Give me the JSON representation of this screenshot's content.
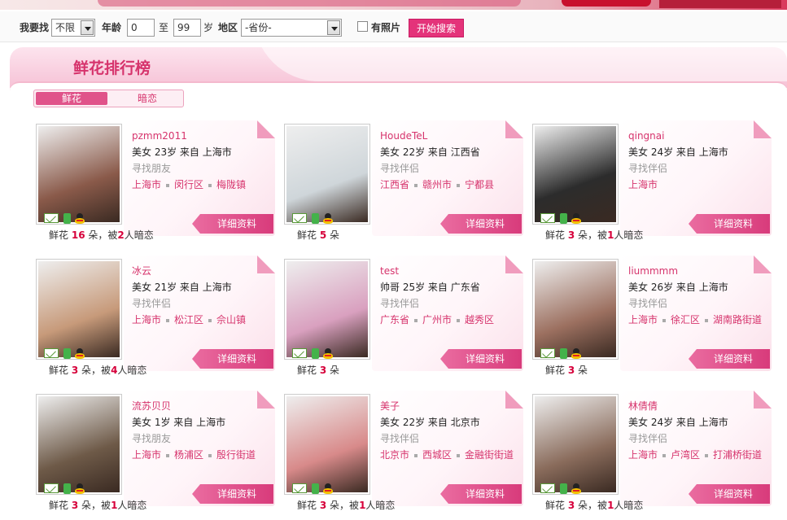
{
  "search": {
    "find_label": "我要找",
    "gender_value": "不限",
    "age_label": "年龄",
    "age_min": "0",
    "age_to": "至",
    "age_max": "99",
    "age_unit": "岁",
    "region_label": "地区",
    "region_value": "-省份-",
    "photo_label": "有照片",
    "search_button": "开始搜索"
  },
  "panel": {
    "title": "鲜花排行榜",
    "tabs": [
      {
        "label": "鲜花",
        "active": true
      },
      {
        "label": "暗恋",
        "active": false
      }
    ]
  },
  "detail_label": "详细资料",
  "cards": [
    {
      "nick": "pzmm2011",
      "desc": "美女 23岁 来自 上海市",
      "purpose": "寻找朋友",
      "loc": [
        "上海市",
        "闵行区",
        "梅陇镇"
      ],
      "flowers": "16",
      "crush": "2",
      "photo_color": "#8a5a4a"
    },
    {
      "nick": "HoudeTeL",
      "desc": "美女 22岁 来自 江西省",
      "purpose": "寻找伴侣",
      "loc": [
        "江西省",
        "赣州市",
        "宁都县"
      ],
      "flowers": "5",
      "crush": null,
      "photo_color": "#cfd6da"
    },
    {
      "nick": "qingnai",
      "desc": "美女 24岁 来自 上海市",
      "purpose": "寻找伴侣",
      "loc": [
        "上海市"
      ],
      "flowers": "3",
      "crush": "1",
      "photo_color": "#2c2c2c"
    },
    {
      "nick": "冰云",
      "desc": "美女 21岁 来自 上海市",
      "purpose": "寻找伴侣",
      "loc": [
        "上海市",
        "松江区",
        "佘山镇"
      ],
      "flowers": "3",
      "crush": "4",
      "photo_color": "#c79a7a"
    },
    {
      "nick": "test",
      "desc": "帅哥 25岁 来自 广东省",
      "purpose": "寻找伴侣",
      "loc": [
        "广东省",
        "广州市",
        "越秀区"
      ],
      "flowers": "3",
      "crush": null,
      "photo_color": "#d9a0bf"
    },
    {
      "nick": "liummmm",
      "desc": "美女 26岁 来自 上海市",
      "purpose": "寻找伴侣",
      "loc": [
        "上海市",
        "徐汇区",
        "湖南路街道"
      ],
      "flowers": "3",
      "crush": null,
      "photo_color": "#9c7060"
    },
    {
      "nick": "流苏贝贝",
      "desc": "美女 1岁 来自 上海市",
      "purpose": "寻找朋友",
      "loc": [
        "上海市",
        "杨浦区",
        "殷行街道"
      ],
      "flowers": "3",
      "crush": "1",
      "photo_color": "#6e5a48"
    },
    {
      "nick": "美子",
      "desc": "美女 22岁 来自 北京市",
      "purpose": "寻找伴侣",
      "loc": [
        "北京市",
        "西城区",
        "金融街街道"
      ],
      "flowers": "3",
      "crush": "1",
      "photo_color": "#d88a8a"
    },
    {
      "nick": "林倩倩",
      "desc": "美女 24岁 来自 上海市",
      "purpose": "寻找伴侣",
      "loc": [
        "上海市",
        "卢湾区",
        "打浦桥街道"
      ],
      "flowers": "3",
      "crush": "1",
      "photo_color": "#8a6c5c"
    }
  ],
  "flowers_prefix": "鲜花",
  "flowers_unit": "朵",
  "crush_prefix": "，被",
  "crush_suffix": "人暗恋"
}
